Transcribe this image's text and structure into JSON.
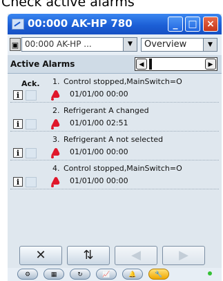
{
  "caption": "Check active alarms",
  "window": {
    "title": "00:000 AK-HP 780",
    "minimize_glyph": "_",
    "maximize_glyph": "□",
    "close_glyph": "×"
  },
  "toolbar": {
    "device_value": "00:000 AK-HP ...",
    "view_value": "Overview"
  },
  "header": {
    "title": "Active Alarms"
  },
  "list": {
    "ack_label": "Ack.",
    "alarms": [
      {
        "num": "1.",
        "text": "Control stopped,MainSwitch=O",
        "time": "01/01/00 00:00"
      },
      {
        "num": "2.",
        "text": "Refrigerant A changed",
        "time": "01/01/00 02:51"
      },
      {
        "num": "3.",
        "text": "Refrigerant A not selected",
        "time": "01/01/00 00:00"
      },
      {
        "num": "4.",
        "text": "Control stopped,MainSwitch=O",
        "time": "01/01/00 00:00"
      }
    ]
  },
  "info_glyph": "i",
  "buttons": {
    "delete": "✕",
    "refresh": "⇅",
    "prev": "◀",
    "next": "▶"
  },
  "icons": {
    "bell_color": "#e0172b",
    "active_nav_color": "#f0a800"
  }
}
